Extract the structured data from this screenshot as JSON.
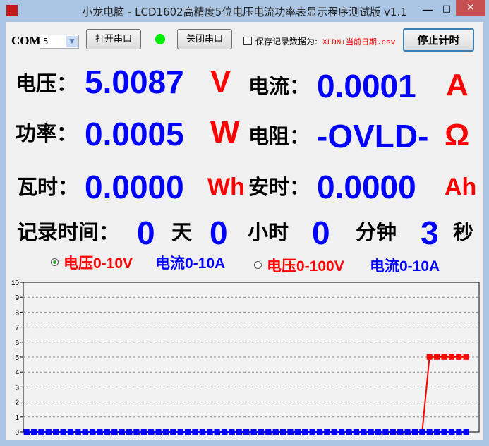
{
  "window": {
    "title": "小龙电脑 - LCD1602高精度5位电压电流功率表显示程序测试版 v1.1",
    "min": "—",
    "max": "□",
    "close": "✕"
  },
  "toolbar": {
    "com_label": "COM",
    "com_value": "5",
    "open_port": "打开串口",
    "close_port": "关闭串口",
    "status_color": "#00ee00",
    "save_label": "保存记录数据为:",
    "save_filename": "XLDN+当前日期.csv",
    "save_checked": false,
    "stop_timer": "停止计时"
  },
  "readings": {
    "voltage": {
      "label": "电压：",
      "value": "5.0087",
      "unit": "V"
    },
    "current": {
      "label": "电流：",
      "value": "0.0001",
      "unit": "A"
    },
    "power": {
      "label": "功率：",
      "value": "0.0005",
      "unit": "W"
    },
    "resistance": {
      "label": "电阻：",
      "value": "-OVLD-",
      "unit": "Ω"
    },
    "energy": {
      "label": "瓦时：",
      "value": "0.0000",
      "unit": "Wh"
    },
    "charge": {
      "label": "安时：",
      "value": "0.0000",
      "unit": "Ah"
    }
  },
  "record_time": {
    "label": "记录时间：",
    "days": "0",
    "days_unit": "天",
    "hours": "0",
    "hours_unit": "小时",
    "minutes": "0",
    "minutes_unit": "分钟",
    "seconds": "3",
    "seconds_unit": "秒"
  },
  "ranges": [
    {
      "v": "电压0-10V",
      "a": "电流0-10A",
      "selected": true
    },
    {
      "v": "电压0-100V",
      "a": "电流0-10A",
      "selected": false
    }
  ],
  "chart_data": {
    "type": "line",
    "ylim": [
      0,
      10
    ],
    "yticks": [
      "0",
      "1",
      "2",
      "3",
      "4",
      "5",
      "6",
      "7",
      "8",
      "9",
      "10"
    ],
    "grid": true,
    "series": [
      {
        "color": "#ff0000",
        "values": [
          0,
          0,
          0,
          0,
          0,
          0,
          0,
          0,
          0,
          0,
          0,
          0,
          0,
          0,
          0,
          0,
          0,
          0,
          0,
          0,
          0,
          0,
          0,
          0,
          0,
          0,
          0,
          0,
          0,
          0,
          0,
          0,
          0,
          0,
          0,
          0,
          0,
          0,
          0,
          0,
          0,
          0,
          0,
          0,
          0,
          0,
          0,
          0,
          0,
          0,
          0,
          0,
          0,
          0,
          0,
          5.0087,
          5.0087,
          5.0087,
          5.0087,
          5.0087,
          5.0087
        ]
      },
      {
        "color": "#0000ff",
        "values": [
          0,
          0,
          0,
          0,
          0,
          0,
          0,
          0,
          0,
          0,
          0,
          0,
          0,
          0,
          0,
          0,
          0,
          0,
          0,
          0,
          0,
          0,
          0,
          0,
          0,
          0,
          0,
          0,
          0,
          0,
          0,
          0,
          0,
          0,
          0,
          0,
          0,
          0,
          0,
          0,
          0,
          0,
          0,
          0,
          0,
          0,
          0,
          0,
          0,
          0,
          0,
          0,
          0,
          0,
          0,
          0.0001,
          0.0001,
          0.0001,
          0.0001,
          0.0001,
          0.0001
        ]
      }
    ]
  }
}
